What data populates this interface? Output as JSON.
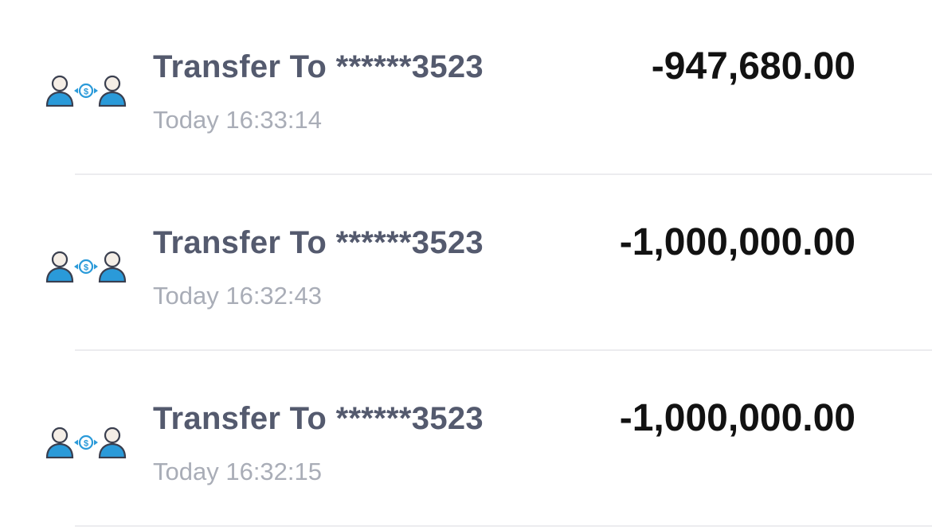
{
  "transactions": [
    {
      "title": "Transfer To ******3523",
      "time": "Today 16:33:14",
      "amount": "-947,680.00",
      "icon": "transfer-people-icon"
    },
    {
      "title": "Transfer To ******3523",
      "time": "Today 16:32:43",
      "amount": "-1,000,000.00",
      "icon": "transfer-people-icon"
    },
    {
      "title": "Transfer To ******3523",
      "time": "Today 16:32:15",
      "amount": "-1,000,000.00",
      "icon": "transfer-people-icon"
    }
  ],
  "colors": {
    "icon_blue": "#2a9ad9",
    "icon_outline": "#3a3f4f",
    "title": "#545a6e",
    "time": "#a9adb7",
    "amount": "#121212",
    "divider": "#ececef"
  }
}
